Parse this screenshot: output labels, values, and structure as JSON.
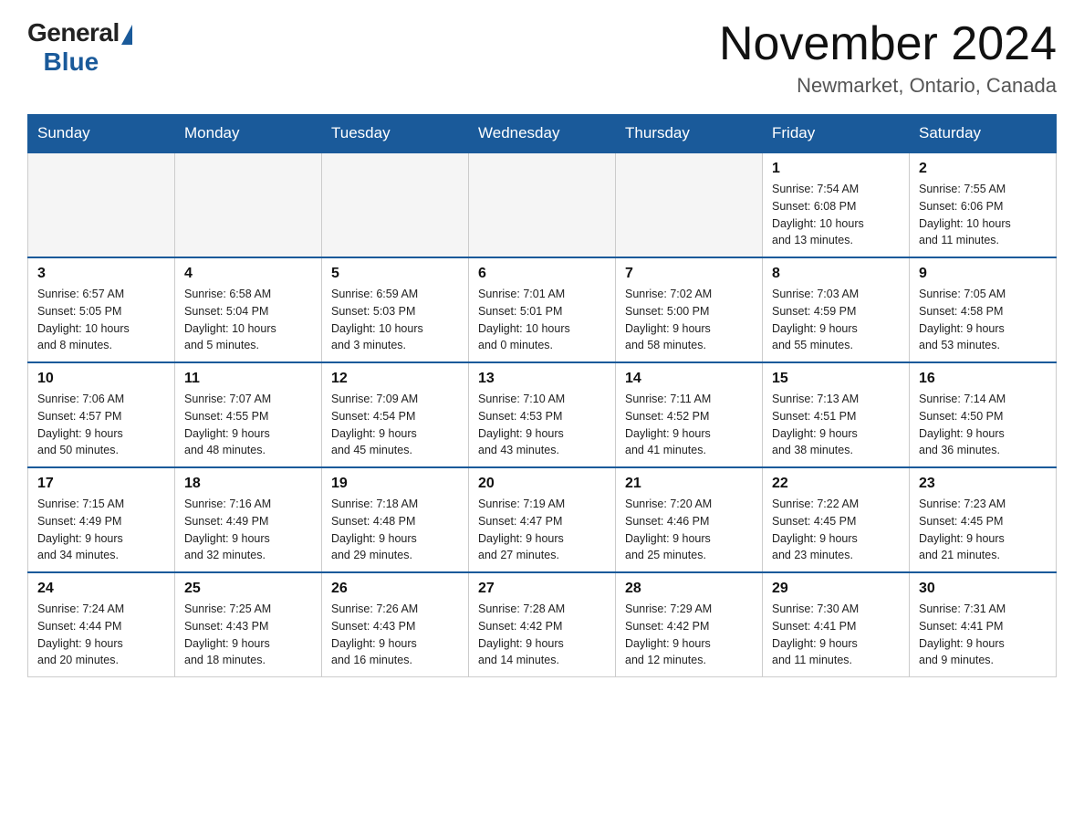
{
  "header": {
    "logo_general": "General",
    "logo_blue": "Blue",
    "month_title": "November 2024",
    "location": "Newmarket, Ontario, Canada"
  },
  "days_of_week": [
    "Sunday",
    "Monday",
    "Tuesday",
    "Wednesday",
    "Thursday",
    "Friday",
    "Saturday"
  ],
  "weeks": [
    [
      {
        "day": "",
        "info": ""
      },
      {
        "day": "",
        "info": ""
      },
      {
        "day": "",
        "info": ""
      },
      {
        "day": "",
        "info": ""
      },
      {
        "day": "",
        "info": ""
      },
      {
        "day": "1",
        "info": "Sunrise: 7:54 AM\nSunset: 6:08 PM\nDaylight: 10 hours\nand 13 minutes."
      },
      {
        "day": "2",
        "info": "Sunrise: 7:55 AM\nSunset: 6:06 PM\nDaylight: 10 hours\nand 11 minutes."
      }
    ],
    [
      {
        "day": "3",
        "info": "Sunrise: 6:57 AM\nSunset: 5:05 PM\nDaylight: 10 hours\nand 8 minutes."
      },
      {
        "day": "4",
        "info": "Sunrise: 6:58 AM\nSunset: 5:04 PM\nDaylight: 10 hours\nand 5 minutes."
      },
      {
        "day": "5",
        "info": "Sunrise: 6:59 AM\nSunset: 5:03 PM\nDaylight: 10 hours\nand 3 minutes."
      },
      {
        "day": "6",
        "info": "Sunrise: 7:01 AM\nSunset: 5:01 PM\nDaylight: 10 hours\nand 0 minutes."
      },
      {
        "day": "7",
        "info": "Sunrise: 7:02 AM\nSunset: 5:00 PM\nDaylight: 9 hours\nand 58 minutes."
      },
      {
        "day": "8",
        "info": "Sunrise: 7:03 AM\nSunset: 4:59 PM\nDaylight: 9 hours\nand 55 minutes."
      },
      {
        "day": "9",
        "info": "Sunrise: 7:05 AM\nSunset: 4:58 PM\nDaylight: 9 hours\nand 53 minutes."
      }
    ],
    [
      {
        "day": "10",
        "info": "Sunrise: 7:06 AM\nSunset: 4:57 PM\nDaylight: 9 hours\nand 50 minutes."
      },
      {
        "day": "11",
        "info": "Sunrise: 7:07 AM\nSunset: 4:55 PM\nDaylight: 9 hours\nand 48 minutes."
      },
      {
        "day": "12",
        "info": "Sunrise: 7:09 AM\nSunset: 4:54 PM\nDaylight: 9 hours\nand 45 minutes."
      },
      {
        "day": "13",
        "info": "Sunrise: 7:10 AM\nSunset: 4:53 PM\nDaylight: 9 hours\nand 43 minutes."
      },
      {
        "day": "14",
        "info": "Sunrise: 7:11 AM\nSunset: 4:52 PM\nDaylight: 9 hours\nand 41 minutes."
      },
      {
        "day": "15",
        "info": "Sunrise: 7:13 AM\nSunset: 4:51 PM\nDaylight: 9 hours\nand 38 minutes."
      },
      {
        "day": "16",
        "info": "Sunrise: 7:14 AM\nSunset: 4:50 PM\nDaylight: 9 hours\nand 36 minutes."
      }
    ],
    [
      {
        "day": "17",
        "info": "Sunrise: 7:15 AM\nSunset: 4:49 PM\nDaylight: 9 hours\nand 34 minutes."
      },
      {
        "day": "18",
        "info": "Sunrise: 7:16 AM\nSunset: 4:49 PM\nDaylight: 9 hours\nand 32 minutes."
      },
      {
        "day": "19",
        "info": "Sunrise: 7:18 AM\nSunset: 4:48 PM\nDaylight: 9 hours\nand 29 minutes."
      },
      {
        "day": "20",
        "info": "Sunrise: 7:19 AM\nSunset: 4:47 PM\nDaylight: 9 hours\nand 27 minutes."
      },
      {
        "day": "21",
        "info": "Sunrise: 7:20 AM\nSunset: 4:46 PM\nDaylight: 9 hours\nand 25 minutes."
      },
      {
        "day": "22",
        "info": "Sunrise: 7:22 AM\nSunset: 4:45 PM\nDaylight: 9 hours\nand 23 minutes."
      },
      {
        "day": "23",
        "info": "Sunrise: 7:23 AM\nSunset: 4:45 PM\nDaylight: 9 hours\nand 21 minutes."
      }
    ],
    [
      {
        "day": "24",
        "info": "Sunrise: 7:24 AM\nSunset: 4:44 PM\nDaylight: 9 hours\nand 20 minutes."
      },
      {
        "day": "25",
        "info": "Sunrise: 7:25 AM\nSunset: 4:43 PM\nDaylight: 9 hours\nand 18 minutes."
      },
      {
        "day": "26",
        "info": "Sunrise: 7:26 AM\nSunset: 4:43 PM\nDaylight: 9 hours\nand 16 minutes."
      },
      {
        "day": "27",
        "info": "Sunrise: 7:28 AM\nSunset: 4:42 PM\nDaylight: 9 hours\nand 14 minutes."
      },
      {
        "day": "28",
        "info": "Sunrise: 7:29 AM\nSunset: 4:42 PM\nDaylight: 9 hours\nand 12 minutes."
      },
      {
        "day": "29",
        "info": "Sunrise: 7:30 AM\nSunset: 4:41 PM\nDaylight: 9 hours\nand 11 minutes."
      },
      {
        "day": "30",
        "info": "Sunrise: 7:31 AM\nSunset: 4:41 PM\nDaylight: 9 hours\nand 9 minutes."
      }
    ]
  ]
}
